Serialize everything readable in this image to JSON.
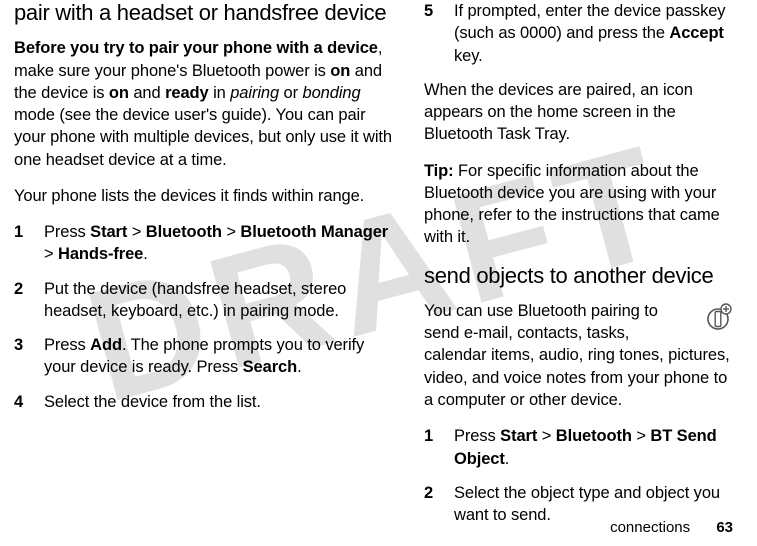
{
  "watermark": "DRAFT",
  "left": {
    "heading": "pair with a headset or handsfree device",
    "intro_bold": "Before you try to pair your phone with a device",
    "intro_rest_1": ", make sure your phone's Bluetooth power is ",
    "on1": "on",
    "intro_rest_2": " and the device is ",
    "on2": "on",
    "intro_rest_3": " and ",
    "ready": "ready",
    "intro_rest_4": " in ",
    "pairing": "pairing",
    "intro_rest_5": " or ",
    "bonding": "bonding",
    "intro_rest_6": " mode (see the device user's guide). You can pair your phone with multiple devices, but only use it with one headset device at a time.",
    "para2": "Your phone lists the devices it finds within range.",
    "steps": [
      {
        "num": "1",
        "pre": "Press ",
        "cmd1": "Start",
        "sep1": " > ",
        "cmd2": "Bluetooth",
        "sep2": " > ",
        "cmd3": "Bluetooth Manager",
        "sep3": " > ",
        "cmd4": "Hands-free",
        "post": "."
      },
      {
        "num": "2",
        "pre": "Put the device (handsfree headset, stereo headset, keyboard, etc.) in pairing mode.",
        "cmd1": "",
        "sep1": "",
        "cmd2": "",
        "sep2": "",
        "cmd3": "",
        "sep3": "",
        "cmd4": "",
        "post": ""
      },
      {
        "num": "3",
        "pre": "Press ",
        "cmd1": "Add",
        "sep1": "",
        "cmd2": "",
        "sep2": "",
        "cmd3": "",
        "sep3": "",
        "cmd4": "",
        "post": ". The phone prompts you to verify your device is ready. Press ",
        "cmd5": "Search",
        "post2": "."
      },
      {
        "num": "4",
        "pre": "Select the device from the list.",
        "cmd1": "",
        "sep1": "",
        "cmd2": "",
        "sep2": "",
        "cmd3": "",
        "sep3": "",
        "cmd4": "",
        "post": ""
      }
    ]
  },
  "right": {
    "step5": {
      "num": "5",
      "pre": "If prompted, enter the device passkey (such as 0000) and press the ",
      "cmd": "Accept",
      "post": " key."
    },
    "para1": "When the devices are paired, an icon appears on the home screen in the Bluetooth Task Tray.",
    "tip_label": "Tip:",
    "tip_rest": " For specific information about the Bluetooth device you are using with your phone, refer to the instructions that came with it.",
    "heading2": "send objects to another device",
    "para2": "You can use Bluetooth pairing to send e-mail, contacts, tasks, calendar items, audio, ring tones, pictures, video, and voice notes from your phone to a computer or other device.",
    "steps2": [
      {
        "num": "1",
        "pre": "Press ",
        "cmd1": "Start",
        "sep1": " > ",
        "cmd2": "Bluetooth",
        "sep2": " > ",
        "cmd3": "BT Send Object",
        "post": "."
      },
      {
        "num": "2",
        "pre": "Select the object type and object you want to send.",
        "cmd1": "",
        "sep1": "",
        "cmd2": "",
        "sep2": "",
        "cmd3": "",
        "post": ""
      }
    ]
  },
  "footer": {
    "section": "connections",
    "page": "63"
  }
}
